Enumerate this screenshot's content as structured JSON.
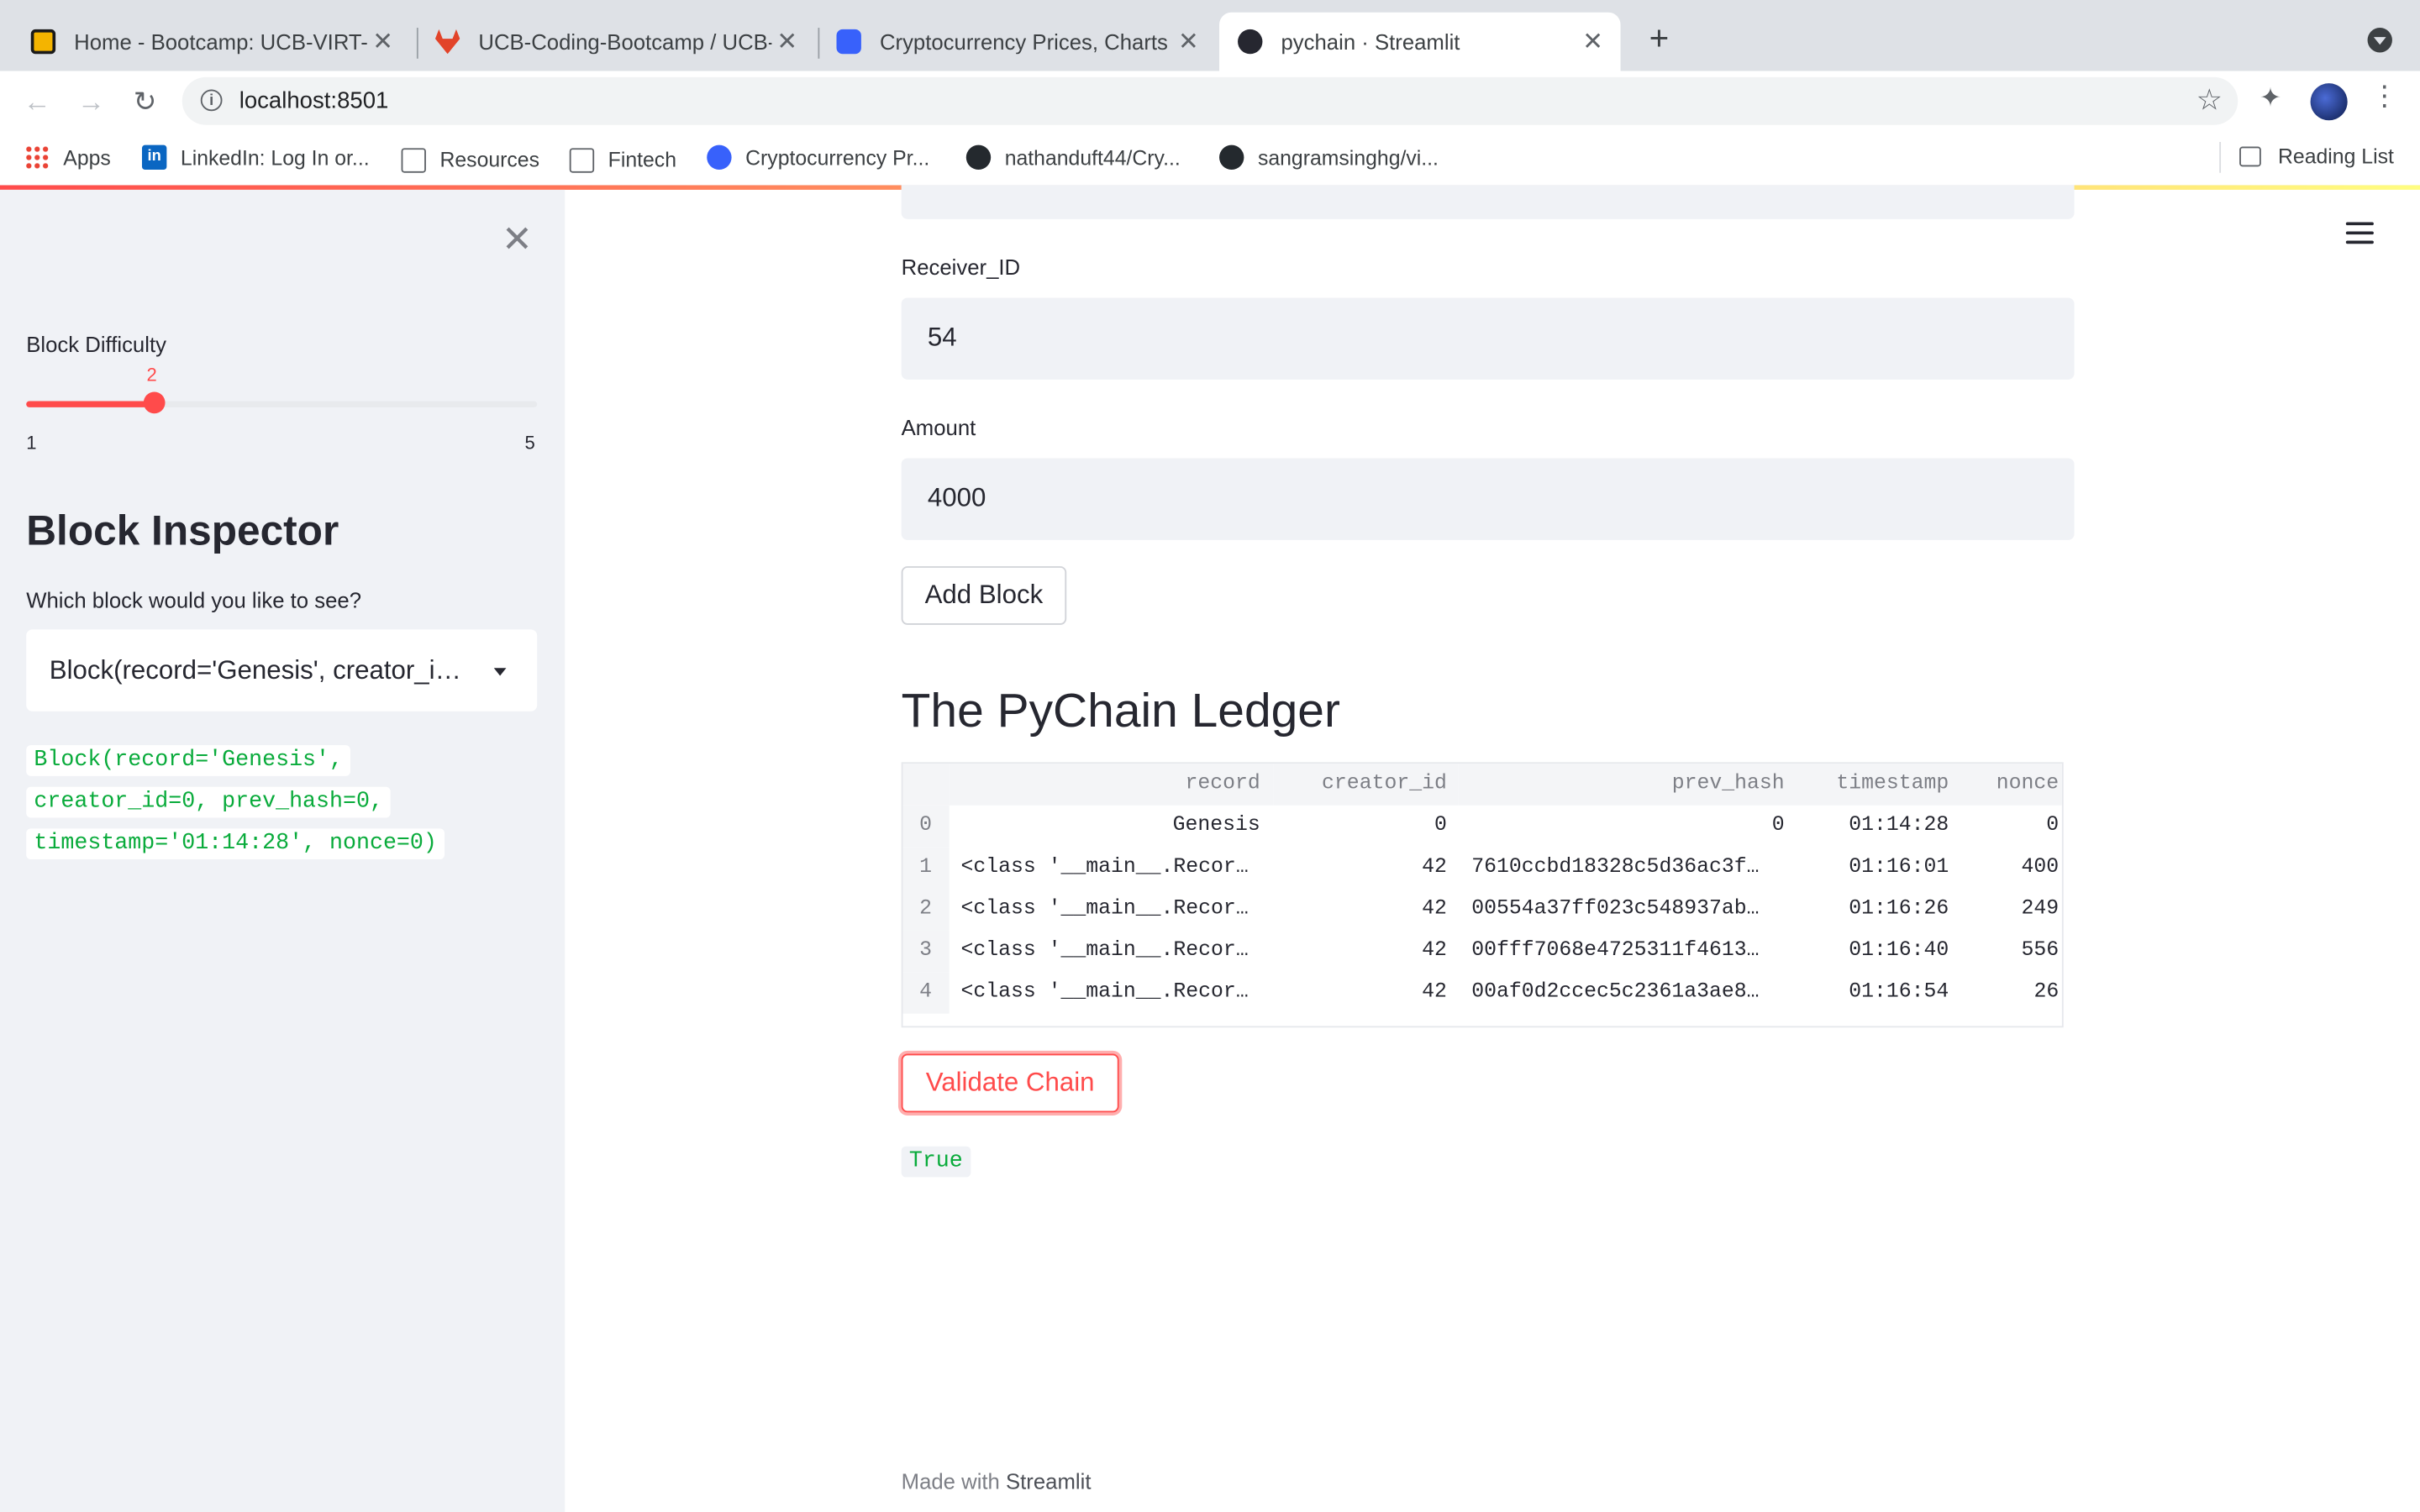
{
  "browser": {
    "tabs": [
      {
        "title": "Home - Bootcamp: UCB-VIRT-",
        "active": false
      },
      {
        "title": "UCB-Coding-Bootcamp / UCB-",
        "active": false
      },
      {
        "title": "Cryptocurrency Prices, Charts",
        "active": false
      },
      {
        "title": "pychain · Streamlit",
        "active": true
      }
    ],
    "url": "localhost:8501",
    "bookmarks": [
      "Apps",
      "LinkedIn: Log In or...",
      "Resources",
      "Fintech",
      "Cryptocurrency Pr...",
      "nathanduft44/Cry...",
      "sangramsinghg/vi..."
    ],
    "reading_list": "Reading List"
  },
  "sidebar": {
    "slider_label": "Block Difficulty",
    "slider_value": "2",
    "slider_min": "1",
    "slider_max": "5",
    "slider_fraction": 0.25,
    "heading": "Block Inspector",
    "question": "Which block would you like to see?",
    "selected_block": "Block(record='Genesis', creator_id=0, prev_hash=0, timestamp='01:14:28', nonce=0)",
    "code_lines": [
      "Block(record='Genesis',",
      "creator_id=0, prev_hash=0,",
      "timestamp='01:14:28', nonce=0)"
    ]
  },
  "main": {
    "receiver_label": "Receiver_ID",
    "receiver_value": "54",
    "amount_label": "Amount",
    "amount_value": "4000",
    "add_block_label": "Add Block",
    "ledger_title": "The PyChain Ledger",
    "table": {
      "columns": [
        "record",
        "creator_id",
        "prev_hash",
        "timestamp",
        "nonce"
      ],
      "rows": [
        {
          "index": "0",
          "record": "Genesis",
          "creator_id": "0",
          "prev_hash": "0",
          "timestamp": "01:14:28",
          "nonce": "0"
        },
        {
          "index": "1",
          "record": "<class '__main__.Recor…",
          "creator_id": "42",
          "prev_hash": "7610ccbd18328c5d36ac3f…",
          "timestamp": "01:16:01",
          "nonce": "400"
        },
        {
          "index": "2",
          "record": "<class '__main__.Recor…",
          "creator_id": "42",
          "prev_hash": "00554a37ff023c548937ab…",
          "timestamp": "01:16:26",
          "nonce": "249"
        },
        {
          "index": "3",
          "record": "<class '__main__.Recor…",
          "creator_id": "42",
          "prev_hash": "00fff7068e4725311f4613…",
          "timestamp": "01:16:40",
          "nonce": "556"
        },
        {
          "index": "4",
          "record": "<class '__main__.Recor…",
          "creator_id": "42",
          "prev_hash": "00af0d2ccec5c2361a3ae8…",
          "timestamp": "01:16:54",
          "nonce": "26"
        }
      ]
    },
    "validate_label": "Validate Chain",
    "validate_result": "True",
    "footer_prefix": "Made with",
    "footer_brand": "Streamlit"
  },
  "colors": {
    "accent": "#ff4b4b",
    "success_text": "#09ab3b",
    "sidebar_bg": "#f0f2f6"
  }
}
